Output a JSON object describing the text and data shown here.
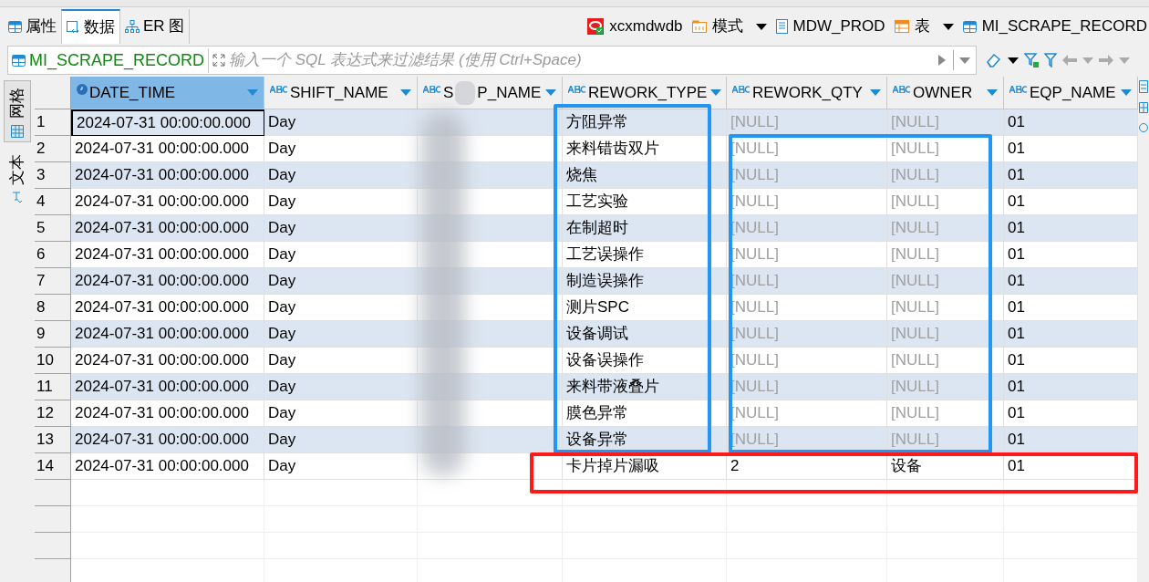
{
  "editor_tabs": [
    {
      "label": "属性",
      "selected": false
    },
    {
      "label": "数据",
      "selected": true
    },
    {
      "label": "ER 图",
      "selected": false
    }
  ],
  "breadcrumb": [
    {
      "label": "xcxmdwdb",
      "dropdown": false
    },
    {
      "label": "模式",
      "dropdown": true
    },
    {
      "label": "MDW_PROD",
      "dropdown": false
    },
    {
      "label": "表",
      "dropdown": true
    },
    {
      "label": "MI_SCRAPE_RECORD",
      "dropdown": false
    }
  ],
  "filter": {
    "table": "MI_SCRAPE_RECORD",
    "placeholder": "输入一个 SQL 表达式来过滤结果 (使用 Ctrl+Space)"
  },
  "view_tabs": [
    {
      "label": "网格",
      "selected": true
    },
    {
      "label": "文本",
      "selected": false
    }
  ],
  "columns": [
    {
      "name": "DATE_TIME",
      "kind": "datetime",
      "selected": true
    },
    {
      "name": "SHIFT_NAME",
      "kind": "text",
      "selected": false
    },
    {
      "name": "S",
      "name_tail": "P_NAME",
      "kind": "text",
      "selected": false,
      "obscured": true
    },
    {
      "name": "REWORK_TYPE",
      "kind": "text",
      "selected": false
    },
    {
      "name": "REWORK_QTY",
      "kind": "text",
      "selected": false
    },
    {
      "name": "OWNER",
      "kind": "text",
      "selected": false
    },
    {
      "name": "EQP_NAME",
      "kind": "text",
      "selected": false
    }
  ],
  "rows": [
    {
      "number": "1",
      "cells": [
        {
          "text": "2024-07-31 00:00:00.000",
          "focused": true
        },
        "Day",
        "方阻异常",
        {
          "text": "[NULL]",
          "kind": "null"
        },
        {
          "text": "[NULL]",
          "kind": "null"
        },
        "01"
      ]
    },
    {
      "number": "2",
      "cells": [
        "2024-07-31 00:00:00.000",
        "Day",
        "来料错齿双片",
        {
          "text": "[NULL]",
          "kind": "null"
        },
        {
          "text": "[NULL]",
          "kind": "null"
        },
        "01"
      ]
    },
    {
      "number": "3",
      "cells": [
        "2024-07-31 00:00:00.000",
        "Day",
        "烧焦",
        {
          "text": "[NULL]",
          "kind": "null"
        },
        {
          "text": "[NULL]",
          "kind": "null"
        },
        "01"
      ]
    },
    {
      "number": "4",
      "cells": [
        "2024-07-31 00:00:00.000",
        "Day",
        "工艺实验",
        {
          "text": "[NULL]",
          "kind": "null"
        },
        {
          "text": "[NULL]",
          "kind": "null"
        },
        "01"
      ]
    },
    {
      "number": "5",
      "cells": [
        "2024-07-31 00:00:00.000",
        "Day",
        "在制超时",
        {
          "text": "[NULL]",
          "kind": "null"
        },
        {
          "text": "[NULL]",
          "kind": "null"
        },
        "01"
      ]
    },
    {
      "number": "6",
      "cells": [
        "2024-07-31 00:00:00.000",
        "Day",
        "工艺误操作",
        {
          "text": "[NULL]",
          "kind": "null"
        },
        {
          "text": "[NULL]",
          "kind": "null"
        },
        "01"
      ]
    },
    {
      "number": "7",
      "cells": [
        "2024-07-31 00:00:00.000",
        "Day",
        "制造误操作",
        {
          "text": "[NULL]",
          "kind": "null"
        },
        {
          "text": "[NULL]",
          "kind": "null"
        },
        "01"
      ]
    },
    {
      "number": "8",
      "cells": [
        "2024-07-31 00:00:00.000",
        "Day",
        "测片SPC",
        {
          "text": "[NULL]",
          "kind": "null"
        },
        {
          "text": "[NULL]",
          "kind": "null"
        },
        "01"
      ]
    },
    {
      "number": "9",
      "cells": [
        "2024-07-31 00:00:00.000",
        "Day",
        "设备调试",
        {
          "text": "[NULL]",
          "kind": "null"
        },
        {
          "text": "[NULL]",
          "kind": "null"
        },
        "01"
      ]
    },
    {
      "number": "10",
      "cells": [
        "2024-07-31 00:00:00.000",
        "Day",
        "设备误操作",
        {
          "text": "[NULL]",
          "kind": "null"
        },
        {
          "text": "[NULL]",
          "kind": "null"
        },
        "01"
      ]
    },
    {
      "number": "11",
      "cells": [
        "2024-07-31 00:00:00.000",
        "Day",
        "来料带液叠片",
        {
          "text": "[NULL]",
          "kind": "null"
        },
        {
          "text": "[NULL]",
          "kind": "null"
        },
        "01"
      ]
    },
    {
      "number": "12",
      "cells": [
        "2024-07-31 00:00:00.000",
        "Day",
        "膜色异常",
        {
          "text": "[NULL]",
          "kind": "null"
        },
        {
          "text": "[NULL]",
          "kind": "null"
        },
        "01"
      ]
    },
    {
      "number": "13",
      "cells": [
        "2024-07-31 00:00:00.000",
        "Day",
        "设备异常",
        {
          "text": "[NULL]",
          "kind": "null"
        },
        {
          "text": "[NULL]",
          "kind": "null"
        },
        "01"
      ]
    },
    {
      "number": "14",
      "cells": [
        "2024-07-31 00:00:00.000",
        "Day",
        "卡片掉片漏吸",
        "2",
        "设备",
        "01"
      ]
    }
  ],
  "annotations": [
    {
      "kind": "box",
      "color": "#2196f3"
    },
    {
      "kind": "box",
      "color": "#2196f3"
    },
    {
      "kind": "box",
      "color": "#ff1a1a"
    }
  ]
}
